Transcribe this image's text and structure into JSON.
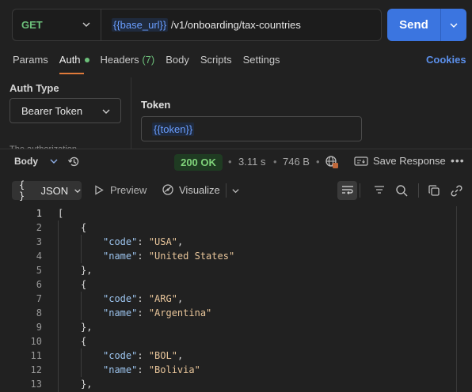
{
  "request": {
    "method": "GET",
    "url_variable": "{{base_url}}",
    "url_path": " /v1/onboarding/tax-countries",
    "send_label": "Send"
  },
  "tabs": [
    {
      "label": "Params"
    },
    {
      "label": "Auth"
    },
    {
      "label": "Headers",
      "count": "(7)"
    },
    {
      "label": "Body"
    },
    {
      "label": "Scripts"
    },
    {
      "label": "Settings"
    }
  ],
  "cookies_label": "Cookies",
  "auth": {
    "type_label": "Auth Type",
    "type_value": "Bearer Token",
    "description": "The authorization",
    "token_label": "Token",
    "token_value": "{{token}}"
  },
  "response": {
    "body_label": "Body",
    "status": "200 OK",
    "time": "3.11 s",
    "size": "746 B",
    "save_label": "Save Response",
    "format": "JSON",
    "preview_label": "Preview",
    "visualize_label": "Visualize"
  },
  "code_lines": [
    {
      "n": "1",
      "text": "["
    },
    {
      "n": "2",
      "text": "{"
    },
    {
      "n": "3",
      "key": "\"code\"",
      "value": "\"USA\"",
      "comma": ","
    },
    {
      "n": "4",
      "key": "\"name\"",
      "value": "\"United States\"",
      "comma": ""
    },
    {
      "n": "5",
      "text": "},"
    },
    {
      "n": "6",
      "text": "{"
    },
    {
      "n": "7",
      "key": "\"code\"",
      "value": "\"ARG\"",
      "comma": ","
    },
    {
      "n": "8",
      "key": "\"name\"",
      "value": "\"Argentina\"",
      "comma": ""
    },
    {
      "n": "9",
      "text": "},"
    },
    {
      "n": "10",
      "text": "{"
    },
    {
      "n": "11",
      "key": "\"code\"",
      "value": "\"BOL\"",
      "comma": ","
    },
    {
      "n": "12",
      "key": "\"name\"",
      "value": "\"Bolivia\"",
      "comma": ""
    },
    {
      "n": "13",
      "text": "},"
    }
  ]
}
